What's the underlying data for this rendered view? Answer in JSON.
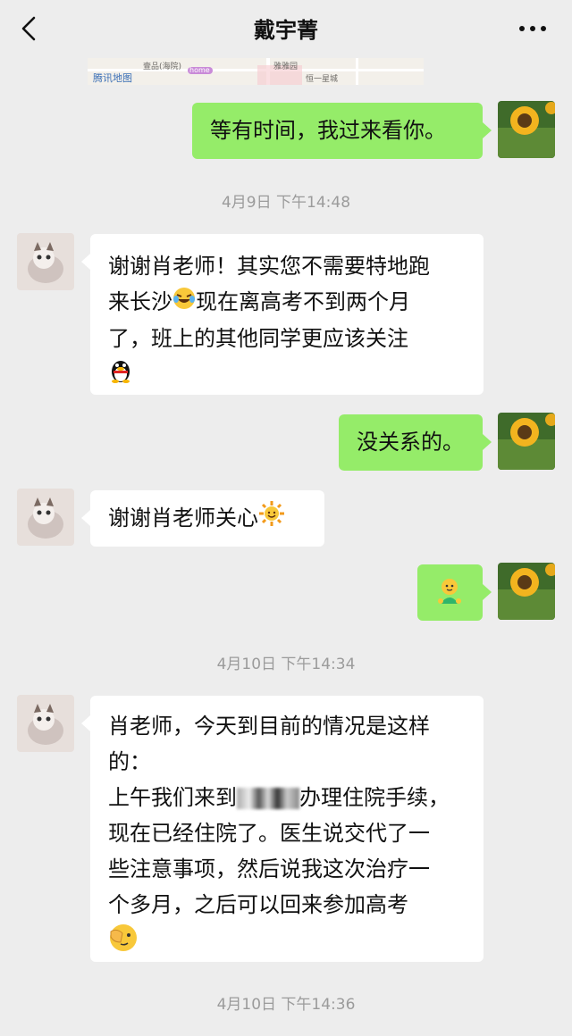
{
  "header": {
    "title": "戴宇菁"
  },
  "map": {
    "logo": "腾讯地图",
    "labels": [
      "壹品(海院)",
      "home",
      "雅雅园",
      "恒一星城"
    ]
  },
  "messages": {
    "m1": "等有时间，我过来看你。",
    "m2_line1": "谢谢肖老师！其实您不需要特地跑",
    "m2_line2_a": "来长沙",
    "m2_line2_b": "现在离高考不到两个月",
    "m2_line3": "了，班上的其他同学更应该关注",
    "m3": "没关系的。",
    "m4": "谢谢肖老师关心",
    "m6_line1": "肖老师，今天到目前的情况是这样",
    "m6_line2": "的：",
    "m6_line3_a": "上午我们来到",
    "m6_line3_b": "办理住院手续，",
    "m6_line4": "现在已经住院了。医生说交代了一",
    "m6_line5": "些注意事项，然后说我这次治疗一",
    "m6_line6": "个多月，之后可以回来参加高考"
  },
  "timestamps": {
    "t1": "4月9日 下午14:48",
    "t2": "4月10日 下午14:34",
    "t3": "4月10日 下午14:36"
  },
  "icons": {
    "emoji_laugh": "tears-of-joy-emoji",
    "emoji_qq": "qq-penguin-emoji",
    "emoji_sun": "sun-emoji",
    "emoji_baby": "baby-emoji",
    "emoji_facepalm": "facepalm-emoji"
  },
  "colors": {
    "self_bubble": "#95ec69",
    "other_bubble": "#ffffff",
    "background": "#ededed"
  }
}
